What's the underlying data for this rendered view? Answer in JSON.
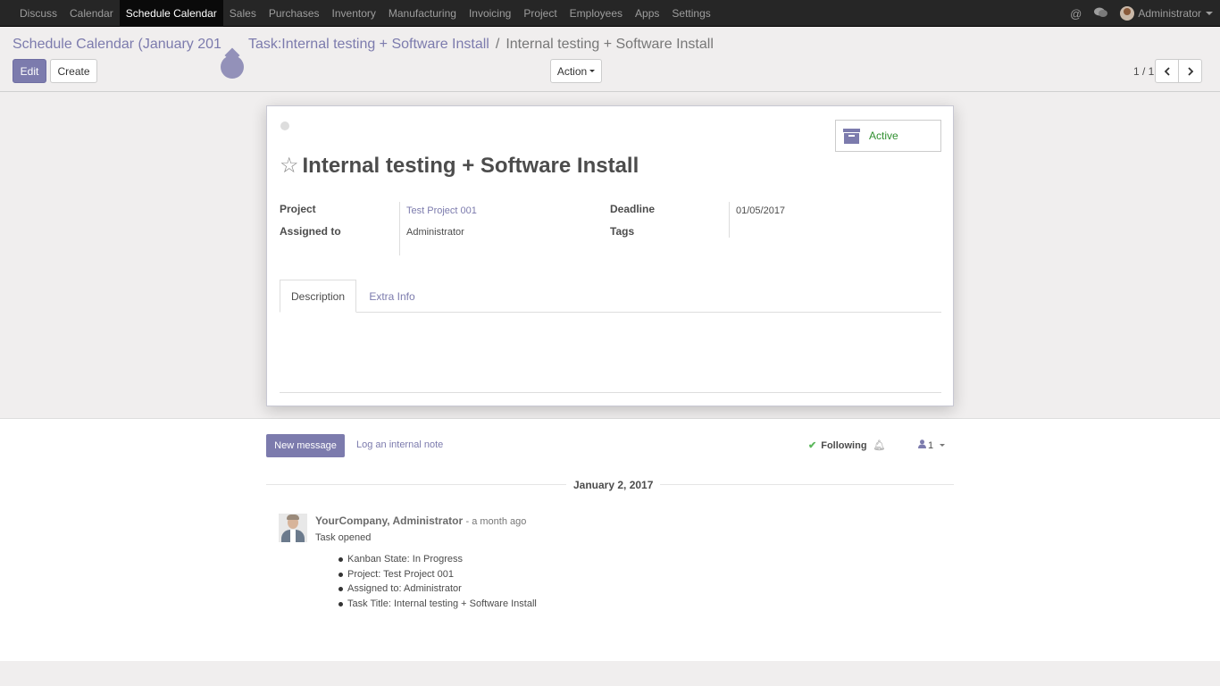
{
  "navbar": {
    "items": [
      "Discuss",
      "Calendar",
      "Schedule Calendar",
      "Sales",
      "Purchases",
      "Inventory",
      "Manufacturing",
      "Invoicing",
      "Project",
      "Employees",
      "Apps",
      "Settings"
    ],
    "active_index": 2,
    "user_name": "Administrator"
  },
  "breadcrumb": {
    "root": "Schedule Calendar (January 201",
    "parent": "Task:Internal testing + Software Install",
    "separator": "/",
    "current": "Internal testing + Software Install"
  },
  "toolbar": {
    "edit_label": "Edit",
    "create_label": "Create",
    "action_label": "Action",
    "pager_value": "1 / 1"
  },
  "form": {
    "status_label": "Active",
    "title": "Internal testing + Software Install",
    "fields": {
      "project_label": "Project",
      "project_value": "Test Project 001",
      "assigned_label": "Assigned to",
      "assigned_value": "Administrator",
      "deadline_label": "Deadline",
      "deadline_value": "01/05/2017",
      "tags_label": "Tags"
    },
    "tabs": [
      "Description",
      "Extra Info"
    ]
  },
  "chatter": {
    "new_message_label": "New message",
    "log_note_label": "Log an internal note",
    "following_label": "Following",
    "followers_count": "1",
    "date_label": "January 2, 2017",
    "message": {
      "author": "YourCompany, Administrator",
      "time": "- a month ago",
      "body": "Task opened",
      "changes": [
        "Kanban State: In Progress",
        "Project: Test Project 001",
        "Assigned to: Administrator",
        "Task Title: Internal testing + Software Install"
      ]
    }
  },
  "colors": {
    "brand": "#7c7bad",
    "navbar": "#262626",
    "active_status": "#2f8f2f"
  }
}
